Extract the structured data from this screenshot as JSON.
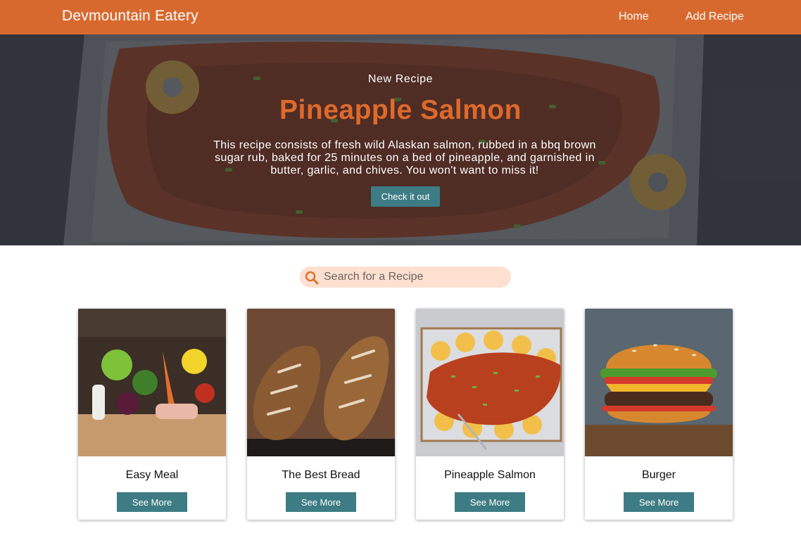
{
  "header": {
    "brand": "Devmountain Eatery",
    "nav": [
      {
        "label": "Home"
      },
      {
        "label": "Add Recipe"
      }
    ]
  },
  "hero": {
    "kicker": "New Recipe",
    "title": "Pineapple Salmon",
    "description": "This recipe consists of fresh wild Alaskan salmon, rubbed in a bbq brown sugar rub, baked for 25 minutes on a bed of pineapple, and garnished in butter, garlic, and chives. You won't want to miss it!",
    "button_label": "Check it out"
  },
  "search": {
    "placeholder": "Search for a Recipe",
    "value": ""
  },
  "recipes": [
    {
      "title": "Easy Meal",
      "button_label": "See More",
      "image": "groceries-photo"
    },
    {
      "title": "The Best Bread",
      "button_label": "See More",
      "image": "bread-photo"
    },
    {
      "title": "Pineapple Salmon",
      "button_label": "See More",
      "image": "salmon-photo"
    },
    {
      "title": "Burger",
      "button_label": "See More",
      "image": "burger-photo"
    }
  ],
  "colors": {
    "header_bg": "#d8692e",
    "accent_title": "#dd6a2c",
    "button_bg": "#3d7c84",
    "search_bg": "#fde0d0"
  }
}
